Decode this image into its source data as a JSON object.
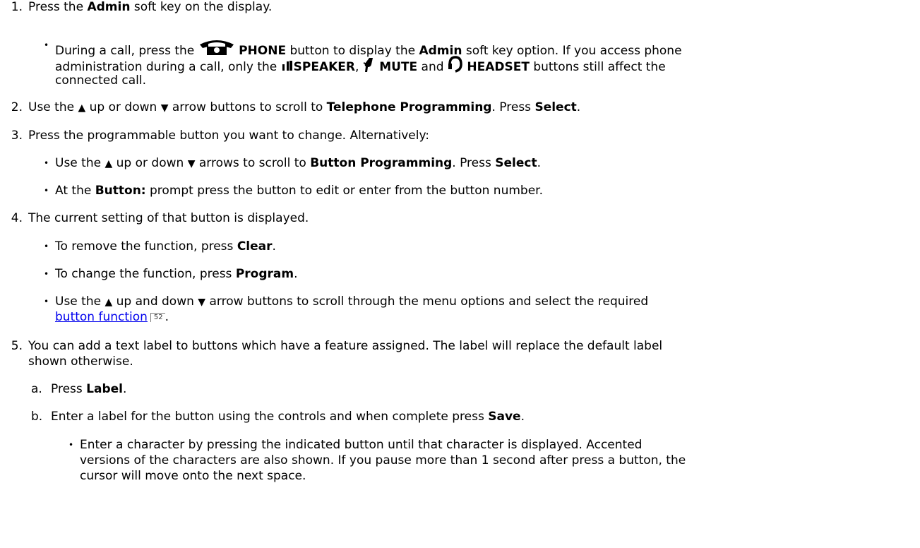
{
  "steps": [
    {
      "num": "1.",
      "pre": "Press the ",
      "b1": "Admin",
      "post": " soft key on the display."
    },
    {
      "num": "2.",
      "t1": "Use the ",
      "t2": " up or down ",
      "t3": " arrow buttons to scroll to ",
      "b1": "Telephone Programming",
      "t4": ". Press ",
      "b2": "Select",
      "t5": "."
    },
    {
      "num": "3.",
      "text": "Press the programmable button you want to change. Alternatively:"
    },
    {
      "num": "4.",
      "text": "The current setting of that button is displayed."
    },
    {
      "num": "5.",
      "line1": "You can add a text label to buttons which have a feature assigned. The label will replace the default label",
      "line2": "shown otherwise."
    }
  ],
  "step1_bullet": {
    "t1": "During a call, press the ",
    "b_phone": "PHONE",
    "t2": " button to display the ",
    "b_admin": "Admin",
    "t3": " soft key option. If you access phone",
    "t4": "administration during a call, only the ",
    "b_speaker": "SPEAKER",
    "t5": ", ",
    "b_mute": "MUTE",
    "t6": " and ",
    "b_headset": "HEADSET",
    "t7": " buttons still affect the",
    "t8": "connected call."
  },
  "step3_bullets": [
    {
      "t1": "Use the ",
      "t2": " up or down ",
      "t3": " arrows to scroll to ",
      "b1": "Button Programming",
      "t4": ". Press ",
      "b2": "Select",
      "t5": "."
    },
    {
      "t1": "At the ",
      "b1": "Button:",
      "t2": " prompt press the button to edit or enter from the button number."
    }
  ],
  "step4_bullets": [
    {
      "t1": "To remove the function, press ",
      "b1": "Clear",
      "t2": "."
    },
    {
      "t1": "To change the function, press ",
      "b1": "Program",
      "t2": "."
    },
    {
      "t1": "Use the ",
      "t2": " up and down ",
      "t3": " arrow buttons to scroll through the menu options and select the required",
      "link": "button function",
      "ref": "52",
      "t4": "."
    }
  ],
  "step5_sub": [
    {
      "letter": "a.",
      "t1": "Press ",
      "b1": "Label",
      "t2": "."
    },
    {
      "letter": "b.",
      "t1": "Enter a label for the button using the controls and when complete press ",
      "b1": "Save",
      "t2": "."
    }
  ],
  "step5b_bullet": {
    "line1": "Enter a character by pressing the indicated button until that character is displayed. Accented",
    "line2": "versions of the characters are also shown. If you pause more than 1 second after press a button, the",
    "line3": "cursor will move onto the next space."
  },
  "icons": {
    "bullet": "•",
    "up_arrow": "▲",
    "down_arrow": "▼"
  }
}
